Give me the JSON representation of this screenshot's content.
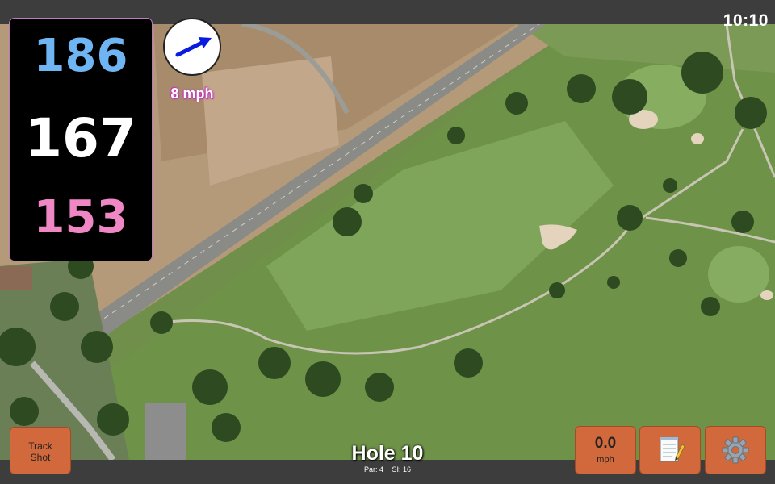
{
  "status": {
    "time": "10:10"
  },
  "distances": {
    "back": "186",
    "middle": "167",
    "front": "153"
  },
  "wind": {
    "icon": "wind-direction-arrow-icon",
    "speed": "8 mph"
  },
  "hole": {
    "title": "Hole 10",
    "par": "Par: 4",
    "si": "SI: 16"
  },
  "buttons": {
    "track_shot": [
      "Track",
      "Shot"
    ],
    "speed_value": "0.0",
    "speed_unit": "mph",
    "notes_icon": "notepad-icon",
    "settings_icon": "gear-icon"
  },
  "colors": {
    "back": "#6fb5f4",
    "middle": "#ffffff",
    "front": "#ef87c5",
    "button": "#d2693c"
  }
}
